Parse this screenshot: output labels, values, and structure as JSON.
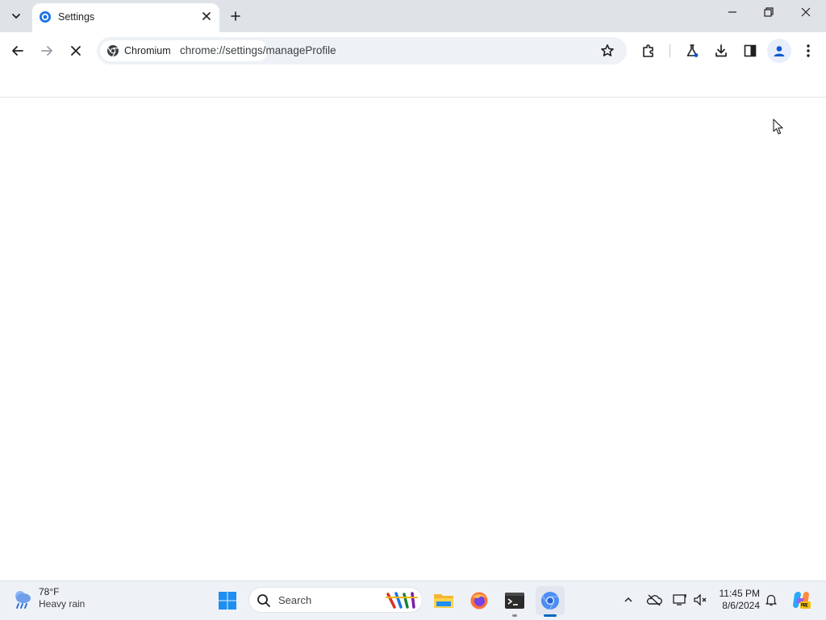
{
  "tab": {
    "title": "Settings",
    "close_label": "×"
  },
  "window_controls": {
    "minimize": "–",
    "maximize": "❐",
    "close": "✕"
  },
  "omnibox": {
    "chip_label": "Chromium",
    "url": "chrome://settings/manageProfile"
  },
  "taskbar": {
    "weather": {
      "temp": "78°F",
      "desc": "Heavy rain"
    },
    "search_label": "Search",
    "clock": {
      "time": "11:45 PM",
      "date": "8/6/2024"
    }
  },
  "colors": {
    "accent": "#0b57d0",
    "chrome_blue": "#1a73e8",
    "titlebar": "#dfe3e8",
    "taskbar": "#eef2f7"
  },
  "icons": [
    "tab-search-icon",
    "settings-favicon",
    "close-icon",
    "plus-icon",
    "back-arrow-icon",
    "forward-arrow-icon",
    "stop-icon",
    "chromium-icon",
    "bookmark-star-icon",
    "extensions-icon",
    "labs-flask-icon",
    "download-icon",
    "side-panel-icon",
    "profile-icon",
    "kebab-menu-icon",
    "weather-icon",
    "windows-start-icon",
    "search-icon",
    "file-explorer-icon",
    "firefox-icon",
    "terminal-icon",
    "chromium-taskbar-icon",
    "chevron-up-icon",
    "onedrive-icon",
    "network-icon",
    "volume-icon",
    "bell-icon",
    "copilot-icon"
  ]
}
